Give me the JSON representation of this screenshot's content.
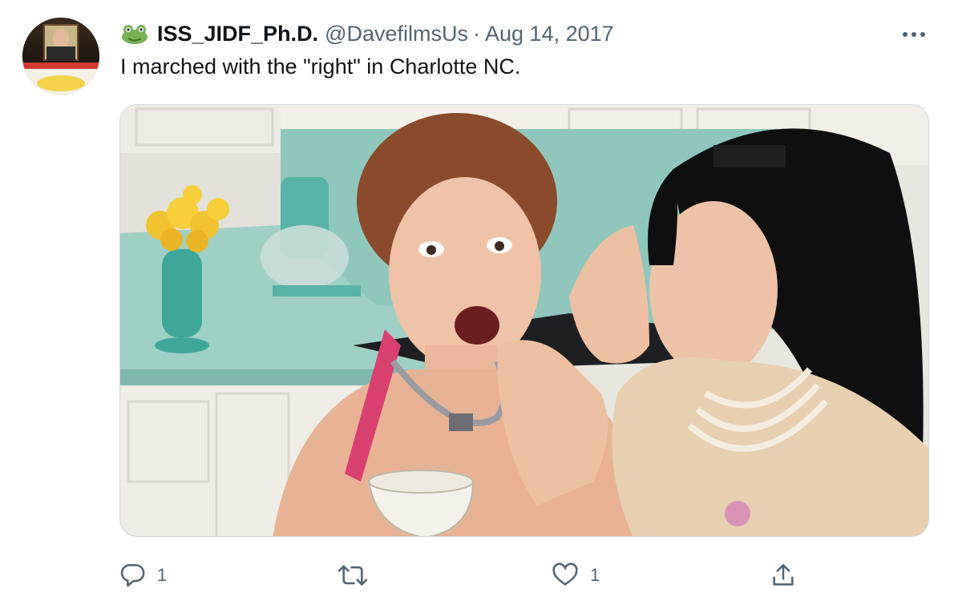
{
  "tweet": {
    "display_name": "ISS_JIDF_Ph.D.",
    "handle": "@DavefilmsUs",
    "separator": "·",
    "date": "Aug 14, 2017",
    "text": "I marched with the \"right\" in Charlotte NC.",
    "name_emoji": "frog-icon",
    "media": {
      "description_icon": "photo",
      "subject": "two women in a retro kitchen whispering"
    }
  },
  "actions": {
    "reply_count": "1",
    "retweet_count": "",
    "like_count": "1"
  },
  "icons": {
    "more": "more-horizontal-icon",
    "reply": "reply-icon",
    "retweet": "retweet-icon",
    "like": "heart-icon",
    "share": "share-icon"
  },
  "colors": {
    "text_primary": "#0f1419",
    "text_secondary": "#536471",
    "border": "#cfd9de"
  }
}
